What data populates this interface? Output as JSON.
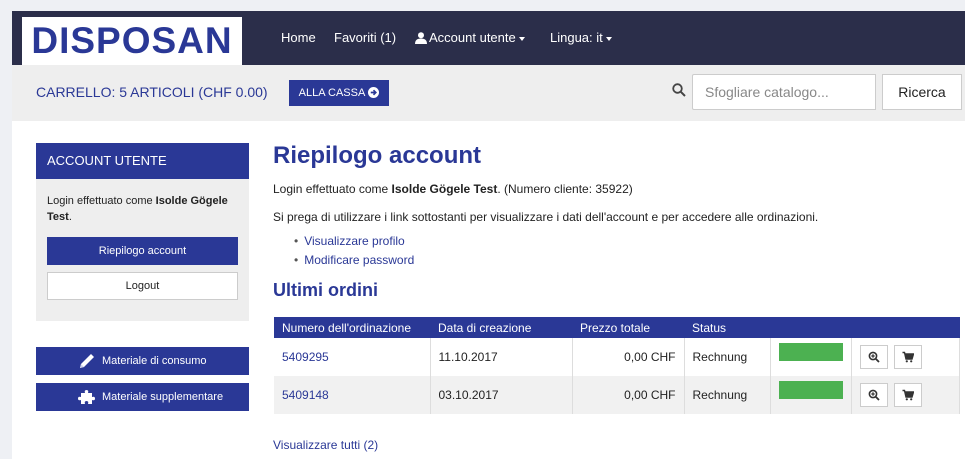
{
  "brand": {
    "logo_text": "DISPOSAN"
  },
  "nav": {
    "home": "Home",
    "favorites": "Favoriti (1)",
    "account": "Account utente",
    "language": "Lingua: it"
  },
  "cart": {
    "summary": "CARRELLO: 5 ARTICOLI (CHF 0.00)",
    "checkout_label": "ALLA CASSA"
  },
  "search": {
    "placeholder": "Sfogliare catalogo...",
    "button_label": "Ricerca"
  },
  "sidebar": {
    "panel_title": "ACCOUNT UTENTE",
    "login_prefix": "Login effettuato come ",
    "login_name": "Isolde Gögele Test",
    "login_suffix": ".",
    "summary_button": "Riepilogo account",
    "logout_button": "Logout",
    "categories": [
      {
        "label": "Materiale di consumo",
        "icon": "pencil-icon"
      },
      {
        "label": "Materiale supplementare",
        "icon": "puzzle-icon"
      }
    ]
  },
  "main": {
    "title": "Riepilogo account",
    "login_prefix": "Login effettuato come ",
    "login_name": "Isolde Gögele Test",
    "login_suffix": ". (Numero cliente: 35922)",
    "instructions": "Si prega di utilizzare i link sottostanti per visualizzare i dati dell'account e per accedere alle ordinazioni.",
    "links": [
      "Visualizzare profilo",
      "Modificare password"
    ],
    "orders_title": "Ultimi ordini",
    "orders_table": {
      "headers": [
        "Numero dell'ordinazione",
        "Data di creazione",
        "Prezzo totale",
        "Status",
        ""
      ],
      "rows": [
        {
          "number": "5409295",
          "date": "11.10.2017",
          "price": "0,00 CHF",
          "status": "Rechnung",
          "progress": 1.0
        },
        {
          "number": "5409148",
          "date": "03.10.2017",
          "price": "0,00 CHF",
          "status": "Rechnung",
          "progress": 1.0
        }
      ]
    },
    "view_all": "Visualizzare tutti (2)"
  },
  "colors": {
    "brand_blue": "#2a3896",
    "navbar": "#2b2e4a",
    "status_green": "#4cb151"
  }
}
